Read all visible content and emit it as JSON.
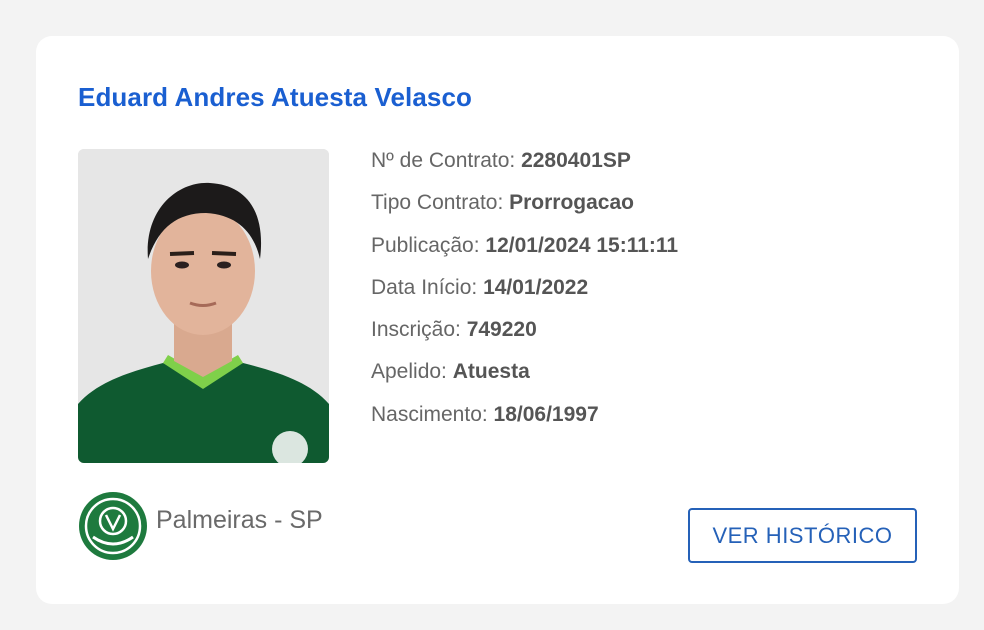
{
  "player": {
    "name": "Eduard Andres Atuesta Velasco",
    "photo_alt": "player-photo"
  },
  "details": [
    {
      "label": "Nº de Contrato: ",
      "value": "2280401SP"
    },
    {
      "label": "Tipo Contrato: ",
      "value": "Prorrogacao"
    },
    {
      "label": "Publicação: ",
      "value": "12/01/2024 15:11:11"
    },
    {
      "label": "Data Início: ",
      "value": "14/01/2022"
    },
    {
      "label": "Inscrição: ",
      "value": "749220"
    },
    {
      "label": "Apelido: ",
      "value": "Atuesta"
    },
    {
      "label": "Nascimento: ",
      "value": "18/06/1997"
    }
  ],
  "club": {
    "name": "Palmeiras - SP",
    "badge_icon": "palmeiras-badge-icon",
    "badge_color": "#1e7a3e"
  },
  "actions": {
    "history_label": "VER HISTÓRICO"
  },
  "colors": {
    "accent": "#1a5fd1",
    "button": "#2561b8"
  }
}
